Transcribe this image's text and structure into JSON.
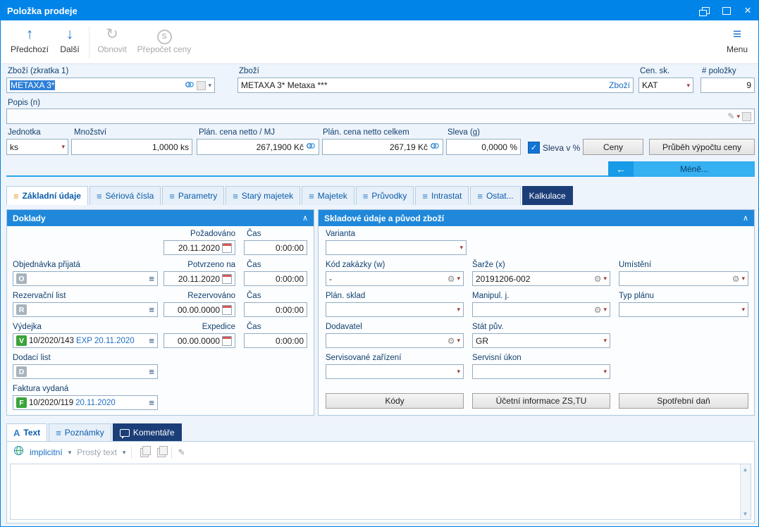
{
  "window": {
    "title": "Položka prodeje"
  },
  "toolbar": {
    "prev": "Předchozí",
    "next": "Další",
    "refresh": "Obnovit",
    "recalc": "Přepočet ceny",
    "menu": "Menu"
  },
  "header": {
    "zbozi_short_label": "Zboží (zkratka 1)",
    "zbozi_short_value": "METAXA 3*",
    "zbozi_label": "Zboží",
    "zbozi_value": "METAXA 3* Metaxa ***",
    "zbozi_link": "Zboží",
    "cen_sk_label": "Cen. sk.",
    "cen_sk_value": "KAT",
    "pocet_label": "# položky",
    "pocet_value": "9",
    "popis_label": "Popis (n)",
    "jednotka_label": "Jednotka",
    "jednotka_value": "ks",
    "mnozstvi_label": "Množství",
    "mnozstvi_value": "1,0000 ks",
    "cena_mj_label": "Plán. cena netto / MJ",
    "cena_mj_value": "267,1900 Kč",
    "cena_celkem_label": "Plán. cena netto celkem",
    "cena_celkem_value": "267,19 Kč",
    "sleva_label": "Sleva (g)",
    "sleva_value": "0,0000 %",
    "sleva_check_label": "Sleva v %",
    "ceny_button": "Ceny",
    "prubeh_button": "Průběh výpočtu ceny",
    "mene_button": "Méně..."
  },
  "tabs": {
    "items": [
      "Základní údaje",
      "Sériová čísla",
      "Parametry",
      "Starý majetek",
      "Majetek",
      "Průvodky",
      "Intrastat",
      "Ostat...",
      "Kalkulace"
    ]
  },
  "doklady": {
    "title": "Doklady",
    "cas_label": "Čas",
    "pozadovano_label": "Požadováno",
    "pozadovano_date": "20.11.2020",
    "pozadovano_time": "0:00:00",
    "objednavka_label": "Objednávka přijatá",
    "objednavka_badge": "O",
    "potvrzeno_label": "Potvrzeno na",
    "potvrzeno_date": "20.11.2020",
    "potvrzeno_time": "0:00:00",
    "rezervacni_label": "Rezervační list",
    "rezervacni_badge": "R",
    "rezervovano_label": "Rezervováno",
    "rezervovano_date": "00.00.0000",
    "rezervovano_time": "0:00:00",
    "vydejka_label": "Výdejka",
    "vydejka_badge": "V",
    "vydejka_value": "10/2020/143",
    "vydejka_link": "EXP 20.11.2020",
    "expedice_label": "Expedice",
    "expedice_date": "00.00.0000",
    "expedice_time": "0:00:00",
    "dodaci_label": "Dodací list",
    "dodaci_badge": "D",
    "faktura_label": "Faktura vydaná",
    "faktura_badge": "F",
    "faktura_value": "10/2020/119",
    "faktura_link": "20.11.2020"
  },
  "sklad": {
    "title": "Skladové údaje a původ zboží",
    "varianta_label": "Varianta",
    "kod_zakazky_label": "Kód zakázky (w)",
    "kod_zakazky_value": "-",
    "sarze_label": "Šarže (x)",
    "sarze_value": "20191206-002",
    "umisteni_label": "Umístění",
    "plan_sklad_label": "Plán. sklad",
    "manipul_label": "Manipul. j.",
    "typ_planu_label": "Typ plánu",
    "dodavatel_label": "Dodavatel",
    "stat_puv_label": "Stát pův.",
    "stat_puv_value": "GR",
    "serv_zarizeni_label": "Servisované zařízení",
    "serv_ukon_label": "Servisní úkon",
    "kody_button": "Kódy",
    "ucetni_button": "Účetní informace ZS,TU",
    "spotrebni_button": "Spotřební daň"
  },
  "bottom_tabs": {
    "text": "Text",
    "poznamky": "Poznámky",
    "komentare": "Komentáře"
  },
  "editor": {
    "implicitni": "implicitní",
    "prosty_text": "Prostý text"
  }
}
